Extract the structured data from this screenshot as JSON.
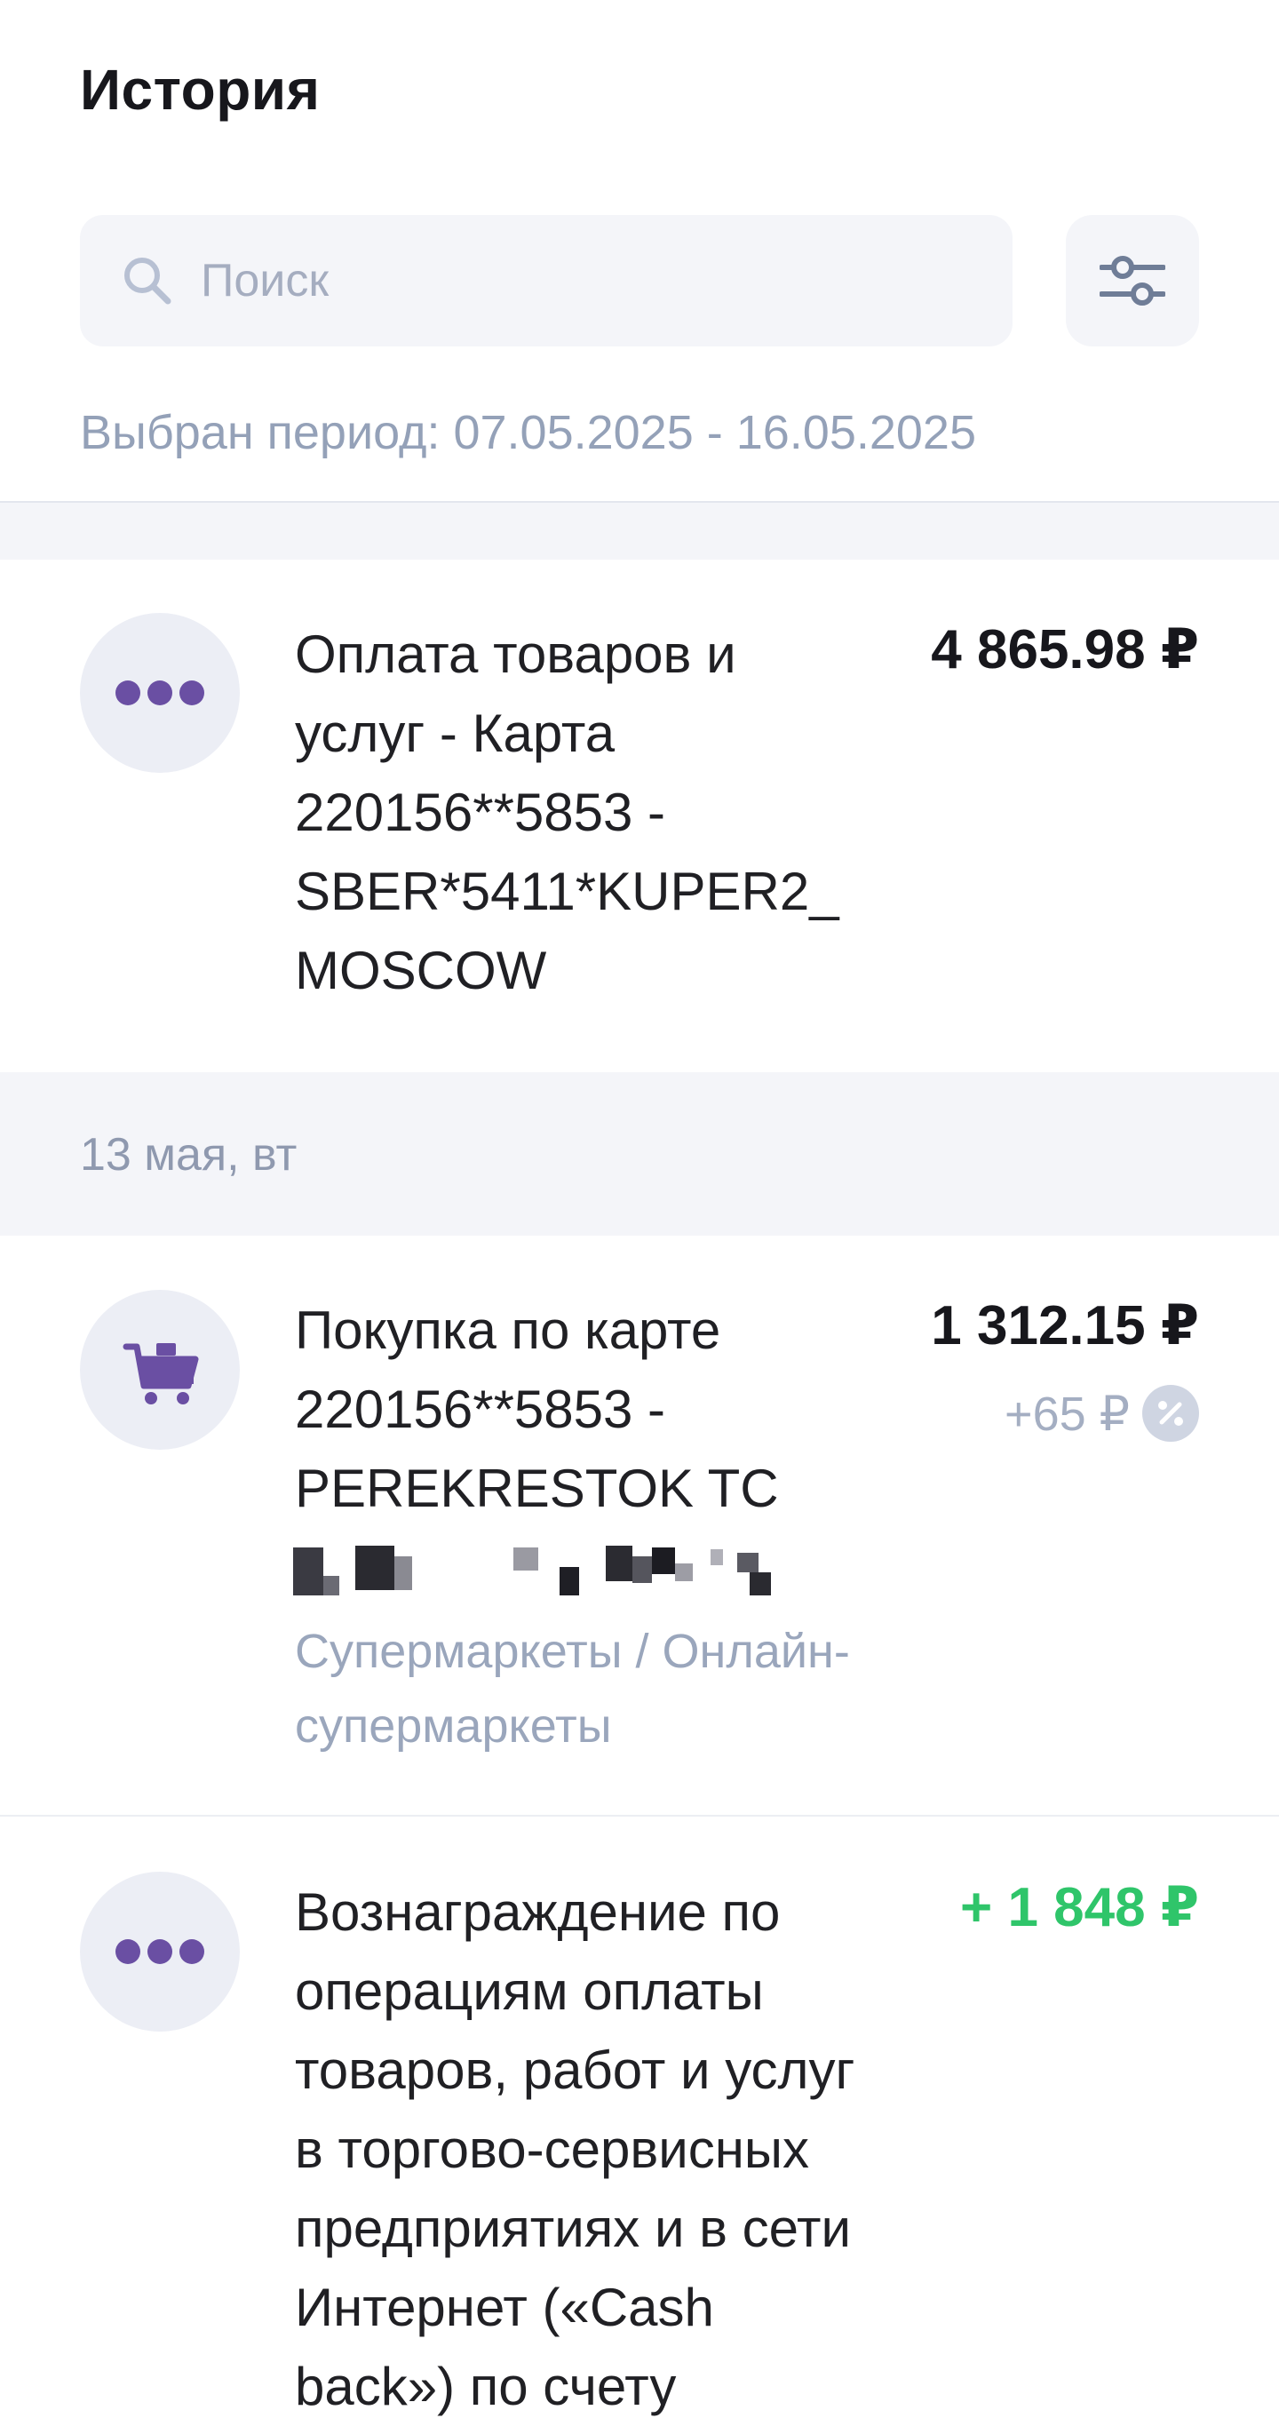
{
  "header": {
    "title": "История",
    "search": {
      "placeholder": "Поиск",
      "value": ""
    },
    "filter_icon": "sliders-icon",
    "period": "Выбран период: 07.05.2025 - 16.05.2025"
  },
  "operations": [
    {
      "icon": "more-dots-icon",
      "title": "Оплата товаров и\nуслуг - Карта\n220156**5853 -\nSBER*5411*KUPER2_\nMOSCOW",
      "amount": "4 865.98 ₽"
    }
  ],
  "groups": [
    {
      "date": "13 мая, вт",
      "operations": [
        {
          "icon": "shopping-cart-icon",
          "title": "Покупка по карте\n220156**5853 -\nPEREKRESTOK TC",
          "amount": "1 312.15 ₽",
          "cashback": "+65 ₽",
          "cashback_icon": "percent-icon",
          "category": "Супермаркеты / Онлайн-\nсупермаркеты"
        },
        {
          "icon": "more-dots-icon",
          "title": "Вознаграждение по\nоперациям оплаты\nтоваров, работ и услуг\nв торгово-сервисных\nпредприятиях и в сети\nИнтернет («Cash\nback») по счету",
          "amount": "+ 1 848 ₽",
          "amount_color": "#2fc56a"
        }
      ]
    }
  ],
  "colors": {
    "accent": "#6a4fa3",
    "income": "#2fc56a",
    "muted_text": "#94a1b8",
    "surface": "#f4f5f9"
  }
}
